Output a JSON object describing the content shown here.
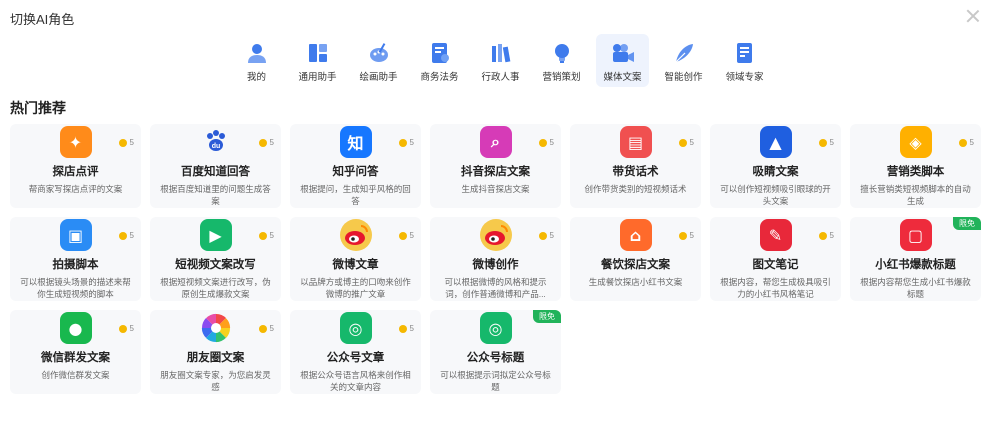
{
  "dialog": {
    "title": "切换AI角色"
  },
  "categories": [
    {
      "label": "我的",
      "icon": "user-icon",
      "color": "#3f7bec",
      "active": false
    },
    {
      "label": "通用助手",
      "icon": "grid-layout-icon",
      "color": "#3f7bec",
      "active": false
    },
    {
      "label": "绘画助手",
      "icon": "palette-icon",
      "color": "#3f7bec",
      "active": false
    },
    {
      "label": "商务法务",
      "icon": "document-user-icon",
      "color": "#3f7bec",
      "active": false
    },
    {
      "label": "行政人事",
      "icon": "books-icon",
      "color": "#3f7bec",
      "active": false
    },
    {
      "label": "营销策划",
      "icon": "lightbulb-icon",
      "color": "#3f7bec",
      "active": false
    },
    {
      "label": "媒体文案",
      "icon": "camera-icon",
      "color": "#3f7bec",
      "active": true
    },
    {
      "label": "智能创作",
      "icon": "quill-icon",
      "color": "#3f7bec",
      "active": false
    },
    {
      "label": "领域专家",
      "icon": "expert-doc-icon",
      "color": "#3f7bec",
      "active": false
    }
  ],
  "section": {
    "title": "热门推荐"
  },
  "cards": [
    {
      "name": "探店点评",
      "desc": "帮商家写探店点评的文案",
      "badge": "5",
      "icon": "person-run-icon",
      "glyph": "✦",
      "color": "#ff8b1a",
      "free": ""
    },
    {
      "name": "百度知道回答",
      "desc": "根据百度知道里的问题生成答案",
      "badge": "5",
      "icon": "baidu-paw-icon",
      "glyph": "du",
      "color": "#ffffff",
      "free": ""
    },
    {
      "name": "知乎问答",
      "desc": "根据提问，生成知乎风格的回答",
      "badge": "5",
      "icon": "zhihu-icon",
      "glyph": "知",
      "color": "#1677ff",
      "free": ""
    },
    {
      "name": "抖音探店文案",
      "desc": "生成抖音探店文案",
      "badge": "5",
      "icon": "magnifier-shop-icon",
      "glyph": "⌕",
      "color": "#d63bb7",
      "free": ""
    },
    {
      "name": "带货话术",
      "desc": "创作带货类别的短视频话术",
      "badge": "5",
      "icon": "shop-sign-icon",
      "glyph": "▤",
      "color": "#f05050",
      "free": ""
    },
    {
      "name": "吸睛文案",
      "desc": "可以创作短视频吸引眼球的开头文案",
      "badge": "5",
      "icon": "chart-shield-icon",
      "glyph": "▲",
      "color": "#1f5fe0",
      "free": ""
    },
    {
      "name": "营销类脚本",
      "desc": "擅长营销类短视频脚本的自动生成",
      "badge": "5",
      "icon": "tag-icon",
      "glyph": "◈",
      "color": "#ffb000",
      "free": ""
    },
    {
      "name": "拍摄脚本",
      "desc": "可以根据镜头场景的描述来帮你生成短视频的脚本",
      "badge": "5",
      "icon": "script-doc-icon",
      "glyph": "▣",
      "color": "#2a8cf5",
      "free": ""
    },
    {
      "name": "短视频文案改写",
      "desc": "根据短视频文案进行改写，伪原创生成爆款文案",
      "badge": "5",
      "icon": "play-icon",
      "glyph": "▶",
      "color": "#16b86b",
      "free": ""
    },
    {
      "name": "微博文章",
      "desc": "以品牌方或博主的口吻来创作微博的推广文章",
      "badge": "5",
      "icon": "weibo-icon",
      "glyph": "◉",
      "color": "#f6c94b",
      "free": ""
    },
    {
      "name": "微博创作",
      "desc": "可以根据微博的风格和提示词，创作普通微博和产品...",
      "badge": "5",
      "icon": "weibo-icon",
      "glyph": "◉",
      "color": "#f6c94b",
      "free": ""
    },
    {
      "name": "餐饮探店文案",
      "desc": "生成餐饮探店小红书文案",
      "badge": "5",
      "icon": "dinner-bell-icon",
      "glyph": "⌂",
      "color": "#ff6a2b",
      "free": ""
    },
    {
      "name": "图文笔记",
      "desc": "根据内容，帮您生成极具吸引力的小红书风格笔记",
      "badge": "5",
      "icon": "note-pen-icon",
      "glyph": "✎",
      "color": "#e8283a",
      "free": ""
    },
    {
      "name": "小红书爆款标题",
      "desc": "根据内容帮您生成小红书爆款标题",
      "badge": "",
      "icon": "calendar-icon",
      "glyph": "▢",
      "color": "#ee2b3c",
      "free": "限免"
    },
    {
      "name": "微信群发文案",
      "desc": "创作微信群发文案",
      "badge": "5",
      "icon": "wechat-icon",
      "glyph": "●",
      "color": "#18b84e",
      "free": ""
    },
    {
      "name": "朋友圈文案",
      "desc": "朋友圈文案专家，为您启发灵感",
      "badge": "5",
      "icon": "aperture-icon",
      "glyph": "✺",
      "color": "#ffffff",
      "free": ""
    },
    {
      "name": "公众号文章",
      "desc": "根据公众号语言风格来创作相关的文章内容",
      "badge": "5",
      "icon": "official-account-icon",
      "glyph": "◎",
      "color": "#16b86b",
      "free": ""
    },
    {
      "name": "公众号标题",
      "desc": "可以根据提示词拟定公众号标题",
      "badge": "",
      "icon": "official-account-icon",
      "glyph": "◎",
      "color": "#16b86b",
      "free": "限免"
    }
  ]
}
